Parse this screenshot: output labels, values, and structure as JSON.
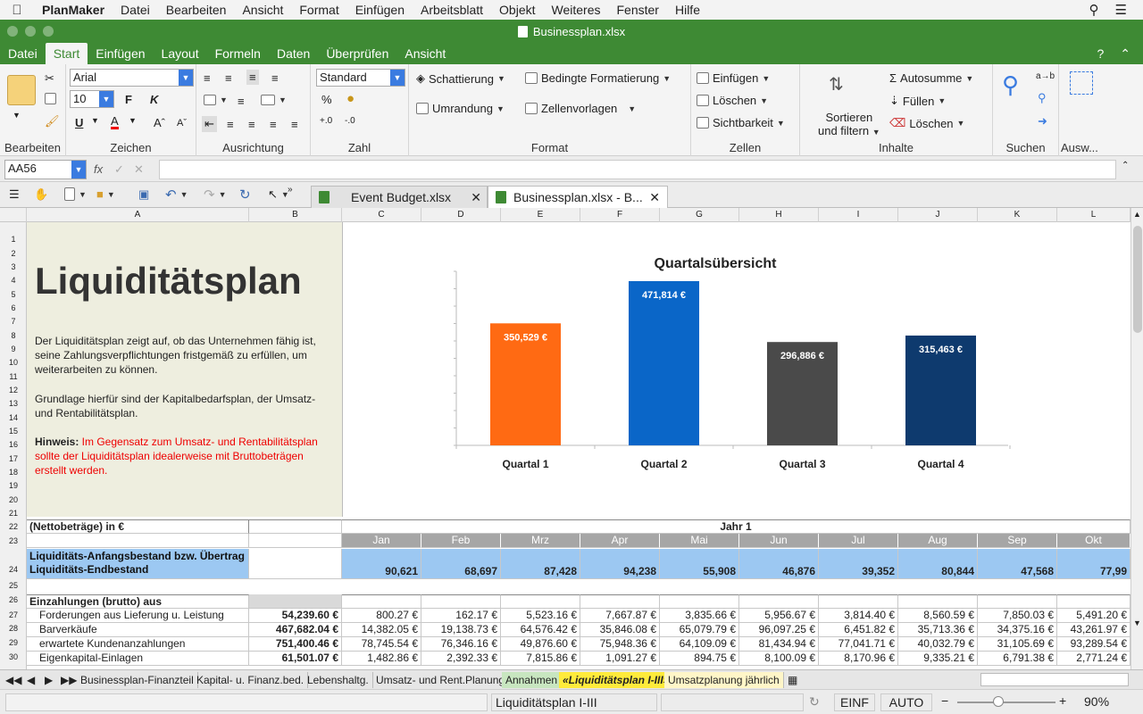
{
  "menubar": {
    "app": "PlanMaker",
    "items": [
      "Datei",
      "Bearbeiten",
      "Ansicht",
      "Format",
      "Einfügen",
      "Arbeitsblatt",
      "Objekt",
      "Weiteres",
      "Fenster",
      "Hilfe"
    ]
  },
  "window": {
    "title": "Businessplan.xlsx"
  },
  "ribbon_tabs": [
    "Datei",
    "Start",
    "Einfügen",
    "Layout",
    "Formeln",
    "Daten",
    "Überprüfen",
    "Ansicht"
  ],
  "ribbon": {
    "groups": {
      "bearbeiten": "Bearbeiten",
      "zeichen": "Zeichen",
      "ausrichtung": "Ausrichtung",
      "zahl": "Zahl",
      "format": "Format",
      "zellen": "Zellen",
      "inhalte": "Inhalte",
      "suchen": "Suchen",
      "auswahl": "Ausw..."
    },
    "font_name": "Arial",
    "font_size": "10",
    "number_format": "Standard",
    "bold": "F",
    "italic": "K",
    "underline": "U",
    "fontcolor": "A",
    "schattierung": "Schattierung",
    "umrandung": "Umrandung",
    "bedingte": "Bedingte Formatierung",
    "zellenvorlagen": "Zellenvorlagen",
    "einfuegen": "Einfügen",
    "loeschen": "Löschen",
    "sichtbarkeit": "Sichtbarkeit",
    "sortieren1": "Sortieren",
    "sortieren2": "und filtern",
    "autosumme": "Autosumme",
    "fuellen": "Füllen",
    "loeschen2": "Löschen",
    "percent": "%",
    "ab": "a→b"
  },
  "formula_bar": {
    "cell_ref": "AA56",
    "fx": "fx",
    "value": ""
  },
  "doc_tabs": [
    "Event Budget.xlsx",
    "Businessplan.xlsx - B..."
  ],
  "columns": [
    "A",
    "B",
    "C",
    "D",
    "E",
    "F",
    "G",
    "H",
    "I",
    "J",
    "K",
    "L"
  ],
  "rows": [
    "1",
    "2",
    "3",
    "4",
    "5",
    "6",
    "7",
    "8",
    "9",
    "10",
    "11",
    "12",
    "13",
    "14",
    "15",
    "16",
    "17",
    "18",
    "19",
    "20",
    "21",
    "22",
    "23",
    "24",
    "25",
    "26",
    "27",
    "28",
    "29",
    "30"
  ],
  "info": {
    "title": "Liquiditätsplan",
    "p1": "Der Liquiditätsplan zeigt auf, ob das Unternehmen fähig ist, seine Zahlungsverpflichtungen fristgemäß zu erfüllen, um weiterarbeiten zu können.",
    "p2": "Grundlage hierfür sind der Kapitalbedarfsplan, der Umsatz- und Rentabilitätsplan.",
    "hint_label": "Hinweis:",
    "hint": " Im Gegensatz zum Umsatz- und Rentabilitätsplan sollte der Liquiditätsplan idealerweise mit Bruttobeträgen erstellt werden."
  },
  "chart_data": {
    "type": "bar",
    "title": "Quartalsübersicht",
    "categories": [
      "Quartal 1",
      "Quartal 2",
      "Quartal 3",
      "Quartal 4"
    ],
    "values": [
      350529,
      471814,
      296886,
      315463
    ],
    "labels": [
      "350,529 €",
      "471,814 €",
      "296,886 €",
      "315,463 €"
    ],
    "colors": [
      "#ff6a13",
      "#0a66c8",
      "#4a4a4a",
      "#0e3a6e"
    ],
    "ylim": [
      0,
      500000
    ]
  },
  "table": {
    "header_a": "(Nettobeträge) in €",
    "year": "Jahr 1",
    "months": [
      "Jan",
      "Feb",
      "Mrz",
      "Apr",
      "Mai",
      "Jun",
      "Jul",
      "Aug",
      "Sep",
      "Okt"
    ],
    "r24a": "Liquiditäts-Anfangsbestand bzw. Übertrag",
    "r24b": "Liquiditäts-Endbestand",
    "endbestand": [
      "90,621",
      "68,697",
      "87,428",
      "94,238",
      "55,908",
      "46,876",
      "39,352",
      "80,844",
      "47,568",
      "77,99"
    ],
    "einzahlungen": "Einzahlungen (brutto) aus",
    "rows": [
      {
        "label": "Forderungen aus Lieferung u. Leistung",
        "total": "54,239.60 €",
        "values": [
          "800.27 €",
          "162.17 €",
          "5,523.16 €",
          "7,667.87 €",
          "3,835.66 €",
          "5,956.67 €",
          "3,814.40 €",
          "8,560.59 €",
          "7,850.03 €",
          "5,491.20 €"
        ]
      },
      {
        "label": "Barverkäufe",
        "total": "467,682.04 €",
        "values": [
          "14,382.05 €",
          "19,138.73 €",
          "64,576.42 €",
          "35,846.08 €",
          "65,079.79 €",
          "96,097.25 €",
          "6,451.82 €",
          "35,713.36 €",
          "34,375.16 €",
          "43,261.97 €"
        ]
      },
      {
        "label": "erwartete Kundenanzahlungen",
        "total": "751,400.46 €",
        "values": [
          "78,745.54 €",
          "76,346.16 €",
          "49,876.60 €",
          "75,948.36 €",
          "64,109.09 €",
          "81,434.94 €",
          "77,041.71 €",
          "40,032.79 €",
          "31,105.69 €",
          "93,289.54 €"
        ]
      },
      {
        "label": "Eigenkapital-Einlagen",
        "total": "61,501.07 €",
        "values": [
          "1,482.86 €",
          "2,392.33 €",
          "7,815.86 €",
          "1,091.27 €",
          "894.75 €",
          "8,100.09 €",
          "8,170.96 €",
          "9,335.21 €",
          "6,791.38 €",
          "2,771.24 €"
        ]
      }
    ]
  },
  "sheet_tabs": [
    "Businessplan-Finanzteil",
    "Kapital- u. Finanz.bed.",
    "Lebenshaltg.",
    "Umsatz- und Rent.Planung",
    "Annahmen",
    "«Liquiditätsplan I-III»",
    "Umsatzplanung jährlich"
  ],
  "status": {
    "sheet": "Liquiditätsplan I-III",
    "mode": "EINF",
    "calc": "AUTO",
    "zoom": "90%"
  }
}
